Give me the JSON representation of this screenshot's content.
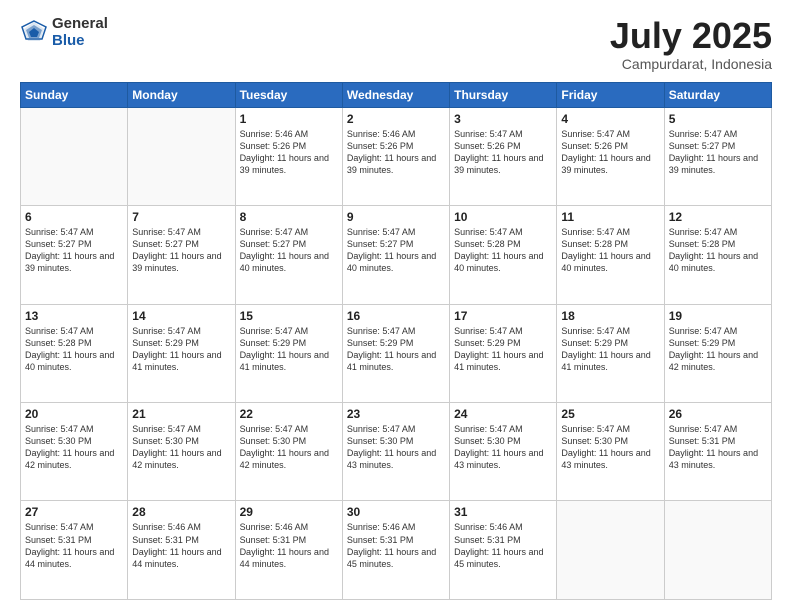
{
  "header": {
    "logo_general": "General",
    "logo_blue": "Blue",
    "title": "July 2025",
    "location": "Campurdarat, Indonesia"
  },
  "days_of_week": [
    "Sunday",
    "Monday",
    "Tuesday",
    "Wednesday",
    "Thursday",
    "Friday",
    "Saturday"
  ],
  "weeks": [
    [
      {
        "day": "",
        "info": ""
      },
      {
        "day": "",
        "info": ""
      },
      {
        "day": "1",
        "info": "Sunrise: 5:46 AM\nSunset: 5:26 PM\nDaylight: 11 hours and 39 minutes."
      },
      {
        "day": "2",
        "info": "Sunrise: 5:46 AM\nSunset: 5:26 PM\nDaylight: 11 hours and 39 minutes."
      },
      {
        "day": "3",
        "info": "Sunrise: 5:47 AM\nSunset: 5:26 PM\nDaylight: 11 hours and 39 minutes."
      },
      {
        "day": "4",
        "info": "Sunrise: 5:47 AM\nSunset: 5:26 PM\nDaylight: 11 hours and 39 minutes."
      },
      {
        "day": "5",
        "info": "Sunrise: 5:47 AM\nSunset: 5:27 PM\nDaylight: 11 hours and 39 minutes."
      }
    ],
    [
      {
        "day": "6",
        "info": "Sunrise: 5:47 AM\nSunset: 5:27 PM\nDaylight: 11 hours and 39 minutes."
      },
      {
        "day": "7",
        "info": "Sunrise: 5:47 AM\nSunset: 5:27 PM\nDaylight: 11 hours and 39 minutes."
      },
      {
        "day": "8",
        "info": "Sunrise: 5:47 AM\nSunset: 5:27 PM\nDaylight: 11 hours and 40 minutes."
      },
      {
        "day": "9",
        "info": "Sunrise: 5:47 AM\nSunset: 5:27 PM\nDaylight: 11 hours and 40 minutes."
      },
      {
        "day": "10",
        "info": "Sunrise: 5:47 AM\nSunset: 5:28 PM\nDaylight: 11 hours and 40 minutes."
      },
      {
        "day": "11",
        "info": "Sunrise: 5:47 AM\nSunset: 5:28 PM\nDaylight: 11 hours and 40 minutes."
      },
      {
        "day": "12",
        "info": "Sunrise: 5:47 AM\nSunset: 5:28 PM\nDaylight: 11 hours and 40 minutes."
      }
    ],
    [
      {
        "day": "13",
        "info": "Sunrise: 5:47 AM\nSunset: 5:28 PM\nDaylight: 11 hours and 40 minutes."
      },
      {
        "day": "14",
        "info": "Sunrise: 5:47 AM\nSunset: 5:29 PM\nDaylight: 11 hours and 41 minutes."
      },
      {
        "day": "15",
        "info": "Sunrise: 5:47 AM\nSunset: 5:29 PM\nDaylight: 11 hours and 41 minutes."
      },
      {
        "day": "16",
        "info": "Sunrise: 5:47 AM\nSunset: 5:29 PM\nDaylight: 11 hours and 41 minutes."
      },
      {
        "day": "17",
        "info": "Sunrise: 5:47 AM\nSunset: 5:29 PM\nDaylight: 11 hours and 41 minutes."
      },
      {
        "day": "18",
        "info": "Sunrise: 5:47 AM\nSunset: 5:29 PM\nDaylight: 11 hours and 41 minutes."
      },
      {
        "day": "19",
        "info": "Sunrise: 5:47 AM\nSunset: 5:29 PM\nDaylight: 11 hours and 42 minutes."
      }
    ],
    [
      {
        "day": "20",
        "info": "Sunrise: 5:47 AM\nSunset: 5:30 PM\nDaylight: 11 hours and 42 minutes."
      },
      {
        "day": "21",
        "info": "Sunrise: 5:47 AM\nSunset: 5:30 PM\nDaylight: 11 hours and 42 minutes."
      },
      {
        "day": "22",
        "info": "Sunrise: 5:47 AM\nSunset: 5:30 PM\nDaylight: 11 hours and 42 minutes."
      },
      {
        "day": "23",
        "info": "Sunrise: 5:47 AM\nSunset: 5:30 PM\nDaylight: 11 hours and 43 minutes."
      },
      {
        "day": "24",
        "info": "Sunrise: 5:47 AM\nSunset: 5:30 PM\nDaylight: 11 hours and 43 minutes."
      },
      {
        "day": "25",
        "info": "Sunrise: 5:47 AM\nSunset: 5:30 PM\nDaylight: 11 hours and 43 minutes."
      },
      {
        "day": "26",
        "info": "Sunrise: 5:47 AM\nSunset: 5:31 PM\nDaylight: 11 hours and 43 minutes."
      }
    ],
    [
      {
        "day": "27",
        "info": "Sunrise: 5:47 AM\nSunset: 5:31 PM\nDaylight: 11 hours and 44 minutes."
      },
      {
        "day": "28",
        "info": "Sunrise: 5:46 AM\nSunset: 5:31 PM\nDaylight: 11 hours and 44 minutes."
      },
      {
        "day": "29",
        "info": "Sunrise: 5:46 AM\nSunset: 5:31 PM\nDaylight: 11 hours and 44 minutes."
      },
      {
        "day": "30",
        "info": "Sunrise: 5:46 AM\nSunset: 5:31 PM\nDaylight: 11 hours and 45 minutes."
      },
      {
        "day": "31",
        "info": "Sunrise: 5:46 AM\nSunset: 5:31 PM\nDaylight: 11 hours and 45 minutes."
      },
      {
        "day": "",
        "info": ""
      },
      {
        "day": "",
        "info": ""
      }
    ]
  ]
}
